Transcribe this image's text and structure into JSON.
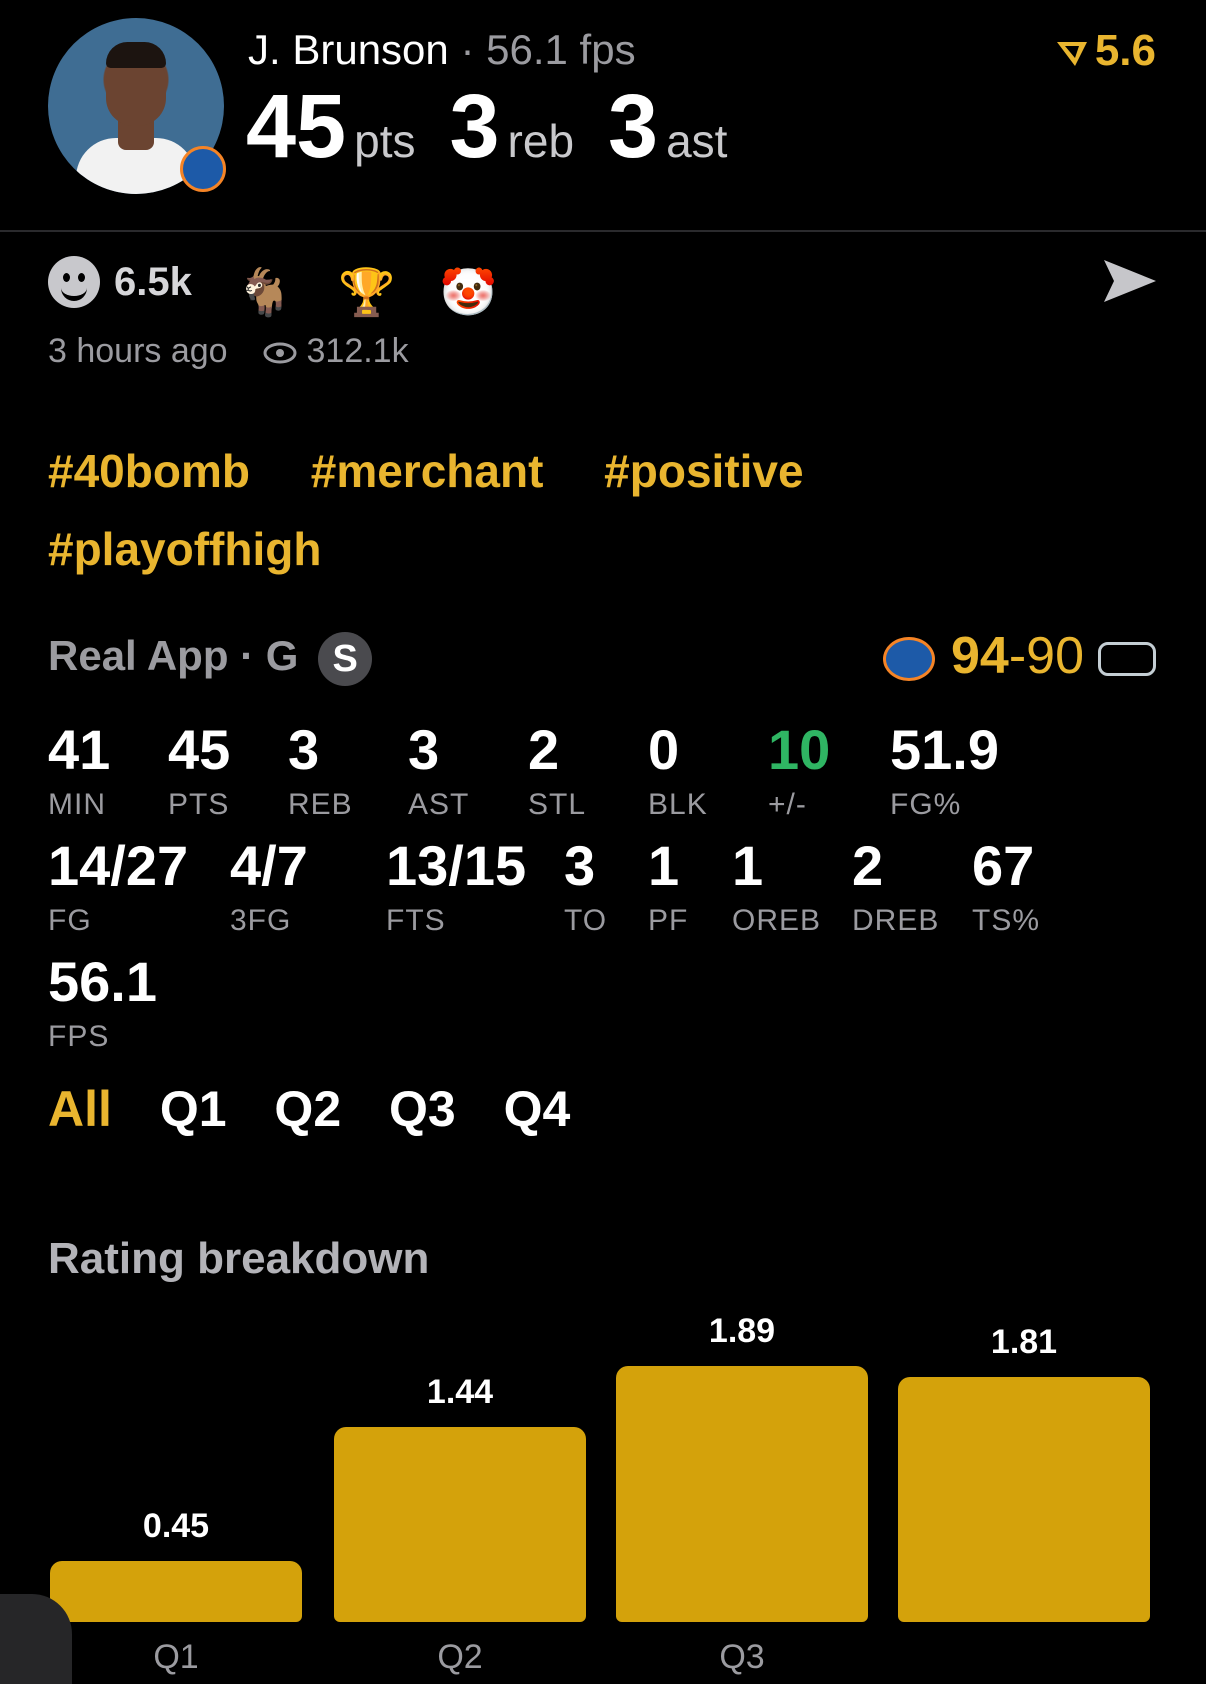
{
  "header": {
    "player_name": "J. Brunson",
    "fps_text": "56.1 fps",
    "separator": "·",
    "pts": "45",
    "pts_unit": "pts",
    "reb": "3",
    "reb_unit": "reb",
    "ast": "3",
    "ast_unit": "ast",
    "rating": "5.6"
  },
  "reactions": {
    "count": "6.5k",
    "emojis": [
      "🐐",
      "🏆",
      "🤡"
    ]
  },
  "meta": {
    "time": "3 hours ago",
    "views": "312.1k"
  },
  "tags": [
    "#40bomb",
    "#merchant",
    "#positive",
    "#playoffhigh"
  ],
  "game": {
    "source": "Real App",
    "position": "· G",
    "badge": "S",
    "team_score": "94",
    "dash": "-",
    "opp_score": "90"
  },
  "stats": [
    {
      "v": "41",
      "l": "MIN"
    },
    {
      "v": "45",
      "l": "PTS"
    },
    {
      "v": "3",
      "l": "REB"
    },
    {
      "v": "3",
      "l": "AST"
    },
    {
      "v": "2",
      "l": "STL"
    },
    {
      "v": "0",
      "l": "BLK"
    },
    {
      "v": "10",
      "l": "+/-"
    },
    {
      "v": "51.9",
      "l": "FG%"
    },
    {
      "v": "14/27",
      "l": "FG"
    },
    {
      "v": "4/7",
      "l": "3FG"
    },
    {
      "v": "13/15",
      "l": "FTS"
    },
    {
      "v": "3",
      "l": "TO"
    },
    {
      "v": "1",
      "l": "PF"
    },
    {
      "v": "1",
      "l": "OREB"
    },
    {
      "v": "2",
      "l": "DREB"
    },
    {
      "v": "67",
      "l": "TS%"
    },
    {
      "v": "56.1",
      "l": "FPS"
    }
  ],
  "tabs": [
    "All",
    "Q1",
    "Q2",
    "Q3",
    "Q4"
  ],
  "breakdown_title": "Rating breakdown",
  "chart_data": {
    "type": "bar",
    "categories": [
      "Q1",
      "Q2",
      "Q3",
      ""
    ],
    "values": [
      0.45,
      1.44,
      1.89,
      1.81
    ],
    "data_labels": [
      "0.45",
      "1.44",
      "1.89",
      "1.81"
    ],
    "ylim": [
      0,
      1.89
    ],
    "bar_color": "#d4a20b"
  }
}
